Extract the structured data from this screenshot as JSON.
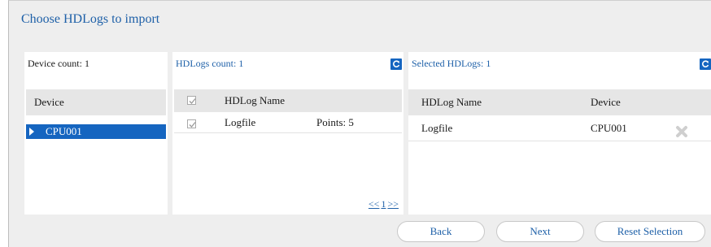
{
  "dialog": {
    "title": "Choose HDLogs to import"
  },
  "device_panel": {
    "count_label": "Device count: 1",
    "column_header": "Device",
    "items": [
      {
        "label": "CPU001",
        "selected": true
      }
    ]
  },
  "hdlogs_panel": {
    "count_label": "HDLogs count: 1",
    "columns": {
      "name": "HDLog Name"
    },
    "rows": [
      {
        "name": "Logfile",
        "points": "Points: 5",
        "checked": true
      }
    ],
    "pager": {
      "prev": "<<",
      "page": "1",
      "next": ">>"
    }
  },
  "selected_panel": {
    "count_label": "Selected HDLogs: 1",
    "columns": {
      "name": "HDLog Name",
      "device": "Device"
    },
    "rows": [
      {
        "name": "Logfile",
        "device": "CPU001"
      }
    ]
  },
  "buttons": {
    "back": "Back",
    "next": "Next",
    "reset": "Reset Selection"
  },
  "colors": {
    "accent": "#1565c0",
    "link": "#1e60a8",
    "header_bg": "#e6e6e6",
    "frame_bg": "#eeeeee"
  },
  "icons": {
    "refresh": "refresh-icon",
    "expand": "expand-triangle-icon",
    "check": "checkmark-icon",
    "remove": "remove-x-icon"
  }
}
